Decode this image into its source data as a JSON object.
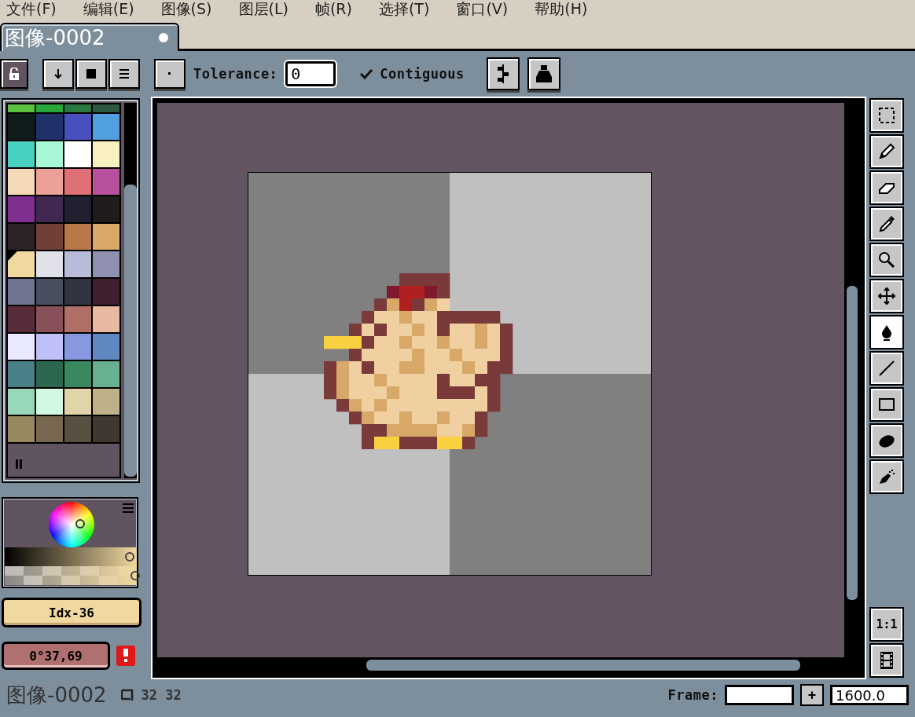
{
  "menu": [
    "文件(F)",
    "编辑(E)",
    "图像(S)",
    "图层(L)",
    "帧(R)",
    "选择(T)",
    "窗口(V)",
    "帮助(H)"
  ],
  "tabs": [
    {
      "label": "图像-0002",
      "selected": true,
      "modified": true
    }
  ],
  "toolbar": {
    "tolerance": {
      "label": "Tolerance:",
      "value": "0"
    },
    "contiguous": {
      "label": "Contiguous",
      "checked": true
    }
  },
  "palette": {
    "swatches": [
      {
        "color": "#5cc040",
        "selected": false
      },
      {
        "color": "#28a838",
        "selected": false
      },
      {
        "color": "#287840",
        "selected": false
      },
      {
        "color": "#2a5840",
        "selected": false
      },
      {
        "color": "#101c1c",
        "selected": false
      },
      {
        "color": "#203068",
        "selected": false
      },
      {
        "color": "#4850c0",
        "selected": false
      },
      {
        "color": "#50a0e0",
        "selected": false
      },
      {
        "color": "#48d0c0",
        "selected": false
      },
      {
        "color": "#a8f8d8",
        "selected": false
      },
      {
        "color": "#ffffff",
        "selected": false
      },
      {
        "color": "#f8f0c0",
        "selected": false
      },
      {
        "color": "#f4d8b8",
        "selected": false
      },
      {
        "color": "#eca098",
        "selected": false
      },
      {
        "color": "#e07078",
        "selected": false
      },
      {
        "color": "#b850a0",
        "selected": false
      },
      {
        "color": "#803090",
        "selected": false
      },
      {
        "color": "#402850",
        "selected": false
      },
      {
        "color": "#202030",
        "selected": false
      },
      {
        "color": "#201c1c",
        "selected": false
      },
      {
        "color": "#2c2424",
        "selected": false
      },
      {
        "color": "#704038",
        "selected": false
      },
      {
        "color": "#b87848",
        "selected": false
      },
      {
        "color": "#d8a868",
        "selected": false
      },
      {
        "color": "#f0d8a0",
        "selected": true
      },
      {
        "color": "#e0e0e8",
        "selected": false
      },
      {
        "color": "#b8bcd8",
        "selected": false
      },
      {
        "color": "#9090b0",
        "selected": false
      },
      {
        "color": "#707490",
        "selected": false
      },
      {
        "color": "#485060",
        "selected": false
      },
      {
        "color": "#303440",
        "selected": false
      },
      {
        "color": "#402030",
        "selected": false
      },
      {
        "color": "#582c38",
        "selected": false
      },
      {
        "color": "#885058",
        "selected": false
      },
      {
        "color": "#b07068",
        "selected": false
      },
      {
        "color": "#e8b8a0",
        "selected": false
      },
      {
        "color": "#e8e8ff",
        "selected": false
      },
      {
        "color": "#c0c0f8",
        "selected": false
      },
      {
        "color": "#8898e0",
        "selected": false
      },
      {
        "color": "#6088c0",
        "selected": false
      },
      {
        "color": "#4c8088",
        "selected": false
      },
      {
        "color": "#2c6850",
        "selected": false
      },
      {
        "color": "#388860",
        "selected": false
      },
      {
        "color": "#68b090",
        "selected": false
      },
      {
        "color": "#98d8b8",
        "selected": false
      },
      {
        "color": "#d0f8e0",
        "selected": false
      },
      {
        "color": "#e0d4a8",
        "selected": false
      },
      {
        "color": "#c0b088",
        "selected": false
      },
      {
        "color": "#988860",
        "selected": false
      },
      {
        "color": "#786850",
        "selected": false
      },
      {
        "color": "#585040",
        "selected": false
      },
      {
        "color": "#403830",
        "selected": false
      }
    ]
  },
  "shade": {
    "level": 0.97
  },
  "alpha": {
    "level": 1
  },
  "color_index": "Idx-36",
  "color_value": "0°37,69",
  "tools": [
    {
      "kind": "marquee",
      "selected": false
    },
    {
      "kind": "pencil",
      "selected": false
    },
    {
      "kind": "eraser",
      "selected": false
    },
    {
      "kind": "eyedropper",
      "selected": false
    },
    {
      "kind": "zoom",
      "selected": false
    },
    {
      "kind": "move",
      "selected": false
    },
    {
      "kind": "bucket",
      "selected": true
    },
    {
      "kind": "line",
      "selected": false
    },
    {
      "kind": "rectangle",
      "selected": false
    },
    {
      "kind": "ellipse",
      "selected": false
    },
    {
      "kind": "spray",
      "selected": false
    }
  ],
  "zoom_reset": "1:1",
  "status": {
    "title": "图像-0002",
    "size": "32 32",
    "frame_label": "Frame:",
    "frame_step": "+",
    "zoom": "1600.0"
  }
}
